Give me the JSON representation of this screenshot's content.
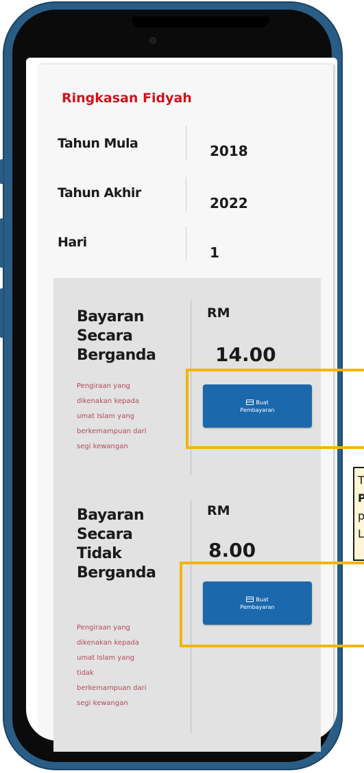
{
  "summary": {
    "title": "Ringkasan Fidyah",
    "rows": [
      {
        "label": "Tahun Mula",
        "value": "2018"
      },
      {
        "label": "Tahun Akhir",
        "value": "2022"
      },
      {
        "label": "Hari",
        "value": "1"
      }
    ]
  },
  "payments": [
    {
      "title_lines": [
        "Bayaran",
        "Secara",
        "Berganda"
      ],
      "description_lines": [
        "Pengiraan yang",
        "dikenakan kepada",
        "umat Islam yang",
        "berkemampuan dari",
        "segi kewangan"
      ],
      "currency": "RM",
      "amount": "14.00",
      "button_line1": "Buat",
      "button_line2": "Pembayaran"
    },
    {
      "title_lines": [
        "Bayaran",
        "Secara",
        "Tidak",
        "Berganda"
      ],
      "description_lines": [
        "Pengiraan yang",
        "dikenakan kepada",
        "umat Islam yang",
        "tidak",
        "berkemampuan dari",
        "segi kewangan"
      ],
      "currency": "RM",
      "amount": "8.00",
      "button_line1": "Buat",
      "button_line2": "Pembayaran"
    }
  ],
  "callout": {
    "line1": "T",
    "line2": "P",
    "line3": "p",
    "line4": "L"
  },
  "colors": {
    "frame": "#2a5d86",
    "accent_red": "#d0121a",
    "button_blue": "#1b68ad",
    "highlight": "#f4b400"
  },
  "icons": {
    "button_icon": "credit-card-icon"
  }
}
